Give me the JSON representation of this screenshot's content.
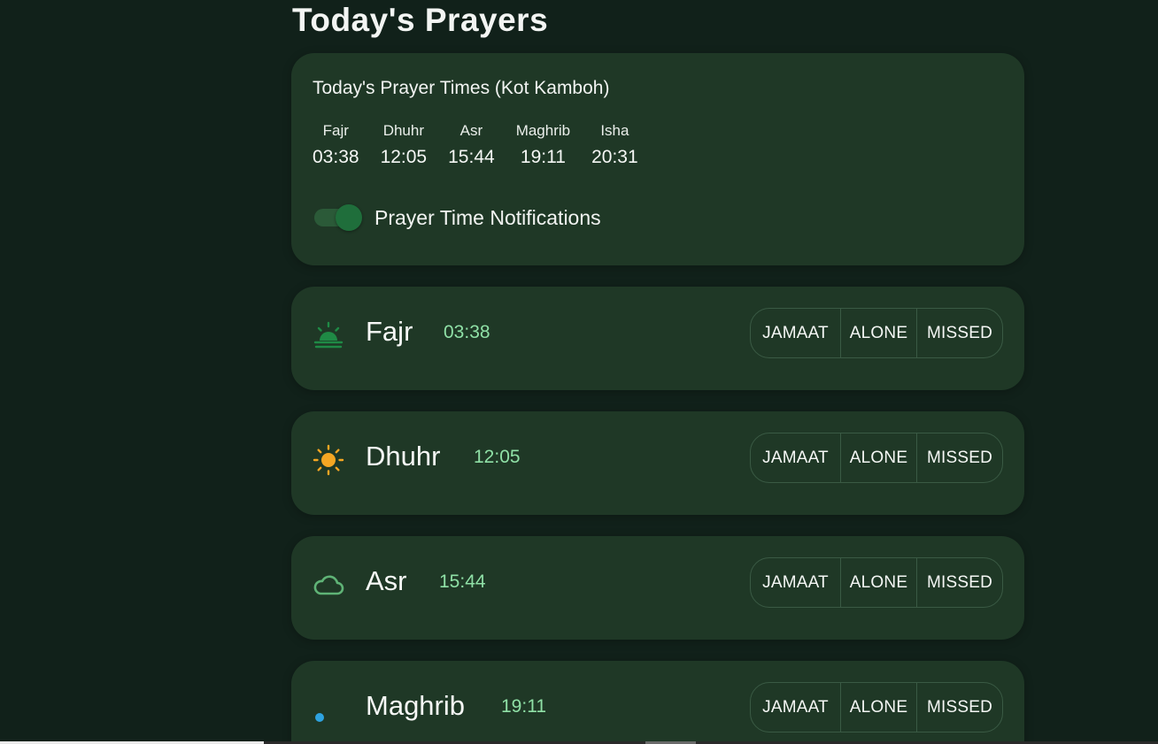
{
  "page": {
    "title": "Today's Prayers"
  },
  "summary": {
    "heading": "Today's Prayer Times (Kot Kamboh)",
    "times": [
      {
        "name": "Fajr",
        "time": "03:38"
      },
      {
        "name": "Dhuhr",
        "time": "12:05"
      },
      {
        "name": "Asr",
        "time": "15:44"
      },
      {
        "name": "Maghrib",
        "time": "19:11"
      },
      {
        "name": "Isha",
        "time": "20:31"
      }
    ],
    "notifications": {
      "label": "Prayer Time Notifications",
      "enabled": true
    }
  },
  "prayers": [
    {
      "name": "Fajr",
      "time": "03:38",
      "icon": "sunrise-icon",
      "icon_color": "#1f8a45"
    },
    {
      "name": "Dhuhr",
      "time": "12:05",
      "icon": "sun-icon",
      "icon_color": "#f5a623"
    },
    {
      "name": "Asr",
      "time": "15:44",
      "icon": "cloud-icon",
      "icon_color": "#5fb376"
    },
    {
      "name": "Maghrib",
      "time": "19:11",
      "icon": "moon-icon",
      "icon_color": "#2ea3e0"
    }
  ],
  "actions": {
    "jamaat": "JAMAAT",
    "alone": "ALONE",
    "missed": "MISSED"
  },
  "colors": {
    "background": "#11211a",
    "card": "#1f3826",
    "accent_time": "#8fe0a6",
    "toggle_on": "#1f6e3b"
  }
}
